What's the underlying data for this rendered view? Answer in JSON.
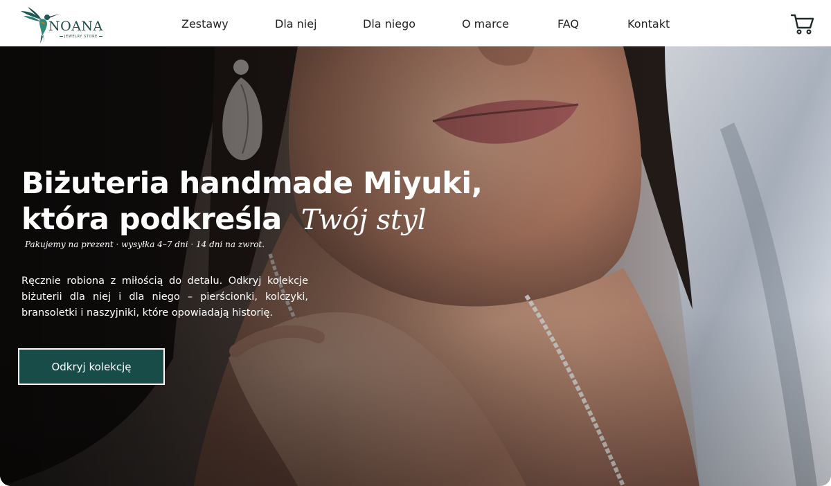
{
  "logo": {
    "name": "NOANA",
    "subtitle": "JEWELRY STORE",
    "icon": "hummingbird-icon"
  },
  "nav": {
    "items": [
      {
        "label": "Zestawy"
      },
      {
        "label": "Dla niej"
      },
      {
        "label": "Dla niego"
      },
      {
        "label": "O marce"
      },
      {
        "label": "FAQ"
      },
      {
        "label": "Kontakt"
      }
    ]
  },
  "cart": {
    "icon": "cart-icon"
  },
  "hero": {
    "headline_line1": "Biżuteria handmade Miyuki,",
    "headline_line2": "która podkreśla",
    "headline_script": "Twój styl",
    "tagline": "Pakujemy na prezent · wysyłka 4–7 dni · 14 dni na zwrot.",
    "description": "Ręcznie robiona z miłością do detalu. Odkryj kolekcje biżuterii dla niej i dla niego – pierścionki, kolczyki, bransoletki i naszyjniki, które opowiadają historię.",
    "cta_label": "Odkryj kolekcję"
  },
  "colors": {
    "brand": "#174c48",
    "logo_text": "#1c4a47",
    "nav_text": "#222222",
    "hero_text": "#ffffff"
  }
}
